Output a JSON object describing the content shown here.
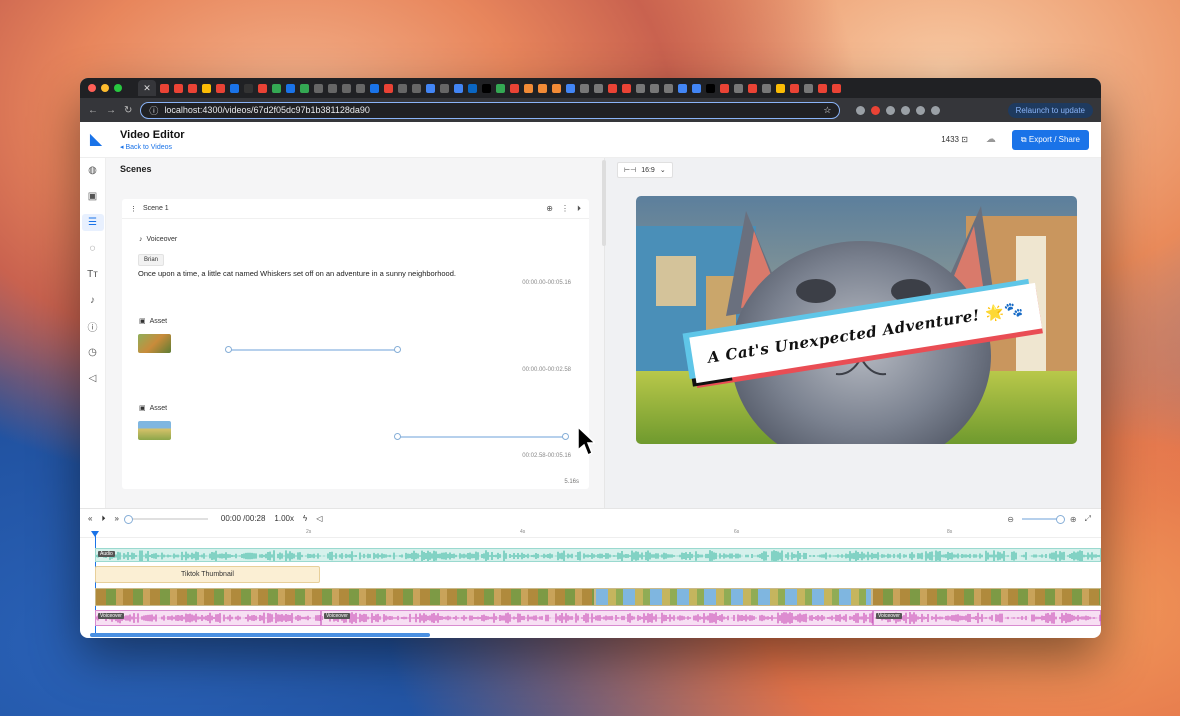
{
  "browser": {
    "url": "localhost:4300/videos/67d2f05dc97b1b381128da90",
    "relaunch_label": "Relaunch to update"
  },
  "header": {
    "title": "Video Editor",
    "back_link": "Back to Videos",
    "credits": "1433",
    "export_label": "Export / Share"
  },
  "sidebar": {
    "items": [
      "globe-icon",
      "image-icon",
      "list-icon",
      "chat-icon",
      "text-icon",
      "mic-icon",
      "info-icon",
      "clock-icon",
      "megaphone-icon"
    ],
    "active_index": 2
  },
  "scenes": {
    "heading": "Scenes",
    "scene_label": "Scene 1",
    "voiceover": {
      "label": "Voiceover",
      "voice": "Brian",
      "text": "Once upon a time, a little cat named Whiskers set off on an adventure in a sunny neighborhood.",
      "time": "00:00.00-00:05.16"
    },
    "assets": [
      {
        "label": "Asset",
        "time": "00:00.00-00:02.58",
        "range": [
          0.11,
          0.54
        ]
      },
      {
        "label": "Asset",
        "time": "00:02.58-00:05.16",
        "range": [
          0.54,
          0.97
        ]
      }
    ],
    "duration": "5.16s"
  },
  "preview": {
    "aspect_ratio": "16:9",
    "title_text": "A Cat's Unexpected Adventure!",
    "title_emoji": "🌟🐾"
  },
  "timeline": {
    "time_display": "00:00 /00:28",
    "speed": "1.00x",
    "ruler_labels": [
      "2s",
      "4s",
      "6s",
      "8s"
    ],
    "audio_label": "Audio",
    "thumbnail_label": "Tiktok Thumbnail",
    "voiceover_chip": "Voiceover"
  },
  "colors": {
    "accent": "#1a73e8",
    "audio_wave": "#2fb39c",
    "voice_wave": "#c33aae"
  }
}
